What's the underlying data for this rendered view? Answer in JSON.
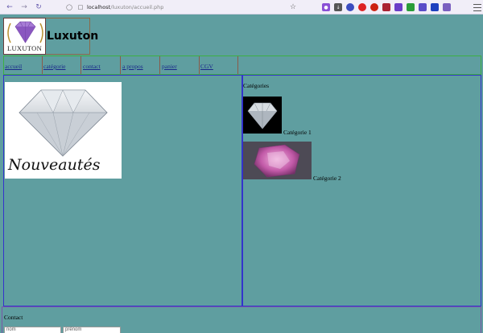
{
  "browser": {
    "url_host": "localhost",
    "url_path": "/luxuton/accueil.php"
  },
  "header": {
    "logo_text": "LUXUTON",
    "site_title": "Luxuton"
  },
  "nav": {
    "items": [
      {
        "label": "accueil"
      },
      {
        "label": "catégorie"
      },
      {
        "label": "contact"
      },
      {
        "label": "a propos"
      },
      {
        "label": "panier"
      },
      {
        "label": "CGV"
      }
    ]
  },
  "main": {
    "featured_text": "Nouveautés"
  },
  "sidebar": {
    "heading": "Catégories",
    "categories": [
      {
        "label": "Catégorie 1"
      },
      {
        "label": "Catégorie 2"
      }
    ]
  },
  "footer": {
    "contact_label": "Contact",
    "fields": [
      {
        "value": "nom"
      },
      {
        "value": "prénom"
      }
    ]
  },
  "colors": {
    "page_background": "#5f9ea0",
    "nav_border": "#3cb043",
    "panel_border": "#3333cc",
    "footer_border": "#7a57a8"
  }
}
